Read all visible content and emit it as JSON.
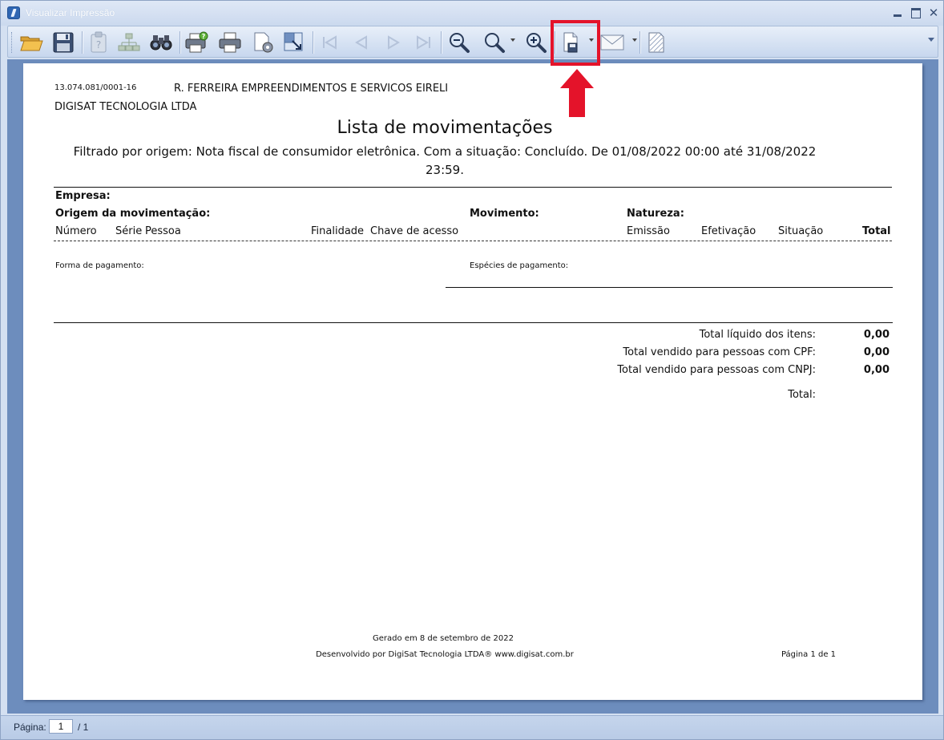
{
  "window": {
    "title": "Visualizar Impressão"
  },
  "toolbar": {
    "buttons": [
      {
        "name": "open-button",
        "icon": "folder-open-icon"
      },
      {
        "name": "save-button",
        "icon": "floppy-disk-icon"
      },
      {
        "name": "parameters-button",
        "icon": "clipboard-icon"
      },
      {
        "name": "document-map-button",
        "icon": "hierarchy-icon"
      },
      {
        "name": "find-button",
        "icon": "binoculars-icon"
      },
      {
        "name": "quick-print-button",
        "icon": "printer-check-icon"
      },
      {
        "name": "print-button",
        "icon": "printer-icon"
      },
      {
        "name": "page-setup-button",
        "icon": "page-gear-icon"
      },
      {
        "name": "scale-button",
        "icon": "page-arrow-icon"
      },
      {
        "name": "first-page-button",
        "icon": "first-page-icon"
      },
      {
        "name": "previous-page-button",
        "icon": "previous-page-icon"
      },
      {
        "name": "next-page-button",
        "icon": "next-page-icon"
      },
      {
        "name": "last-page-button",
        "icon": "last-page-icon"
      },
      {
        "name": "zoom-out-button",
        "icon": "zoom-out-icon"
      },
      {
        "name": "zoom-button",
        "icon": "magnifier-icon"
      },
      {
        "name": "zoom-in-button",
        "icon": "zoom-in-icon"
      },
      {
        "name": "export-button",
        "icon": "export-document-icon"
      },
      {
        "name": "send-email-button",
        "icon": "envelope-icon"
      },
      {
        "name": "watermark-button",
        "icon": "watermark-icon"
      }
    ],
    "accent_highlight": "#e4132a"
  },
  "report": {
    "cnpj": "13.074.081/0001-16",
    "company_name": "R. FERREIRA EMPREENDIMENTOS E SERVICOS EIRELI",
    "developer_company": "DIGISAT TECNOLOGIA LTDA",
    "title": "Lista de movimentações",
    "filter_line1": "Filtrado por origem: Nota fiscal de consumidor eletrônica. Com a situação: Concluído. De 01/08/2022 00:00 até 31/08/2022",
    "filter_line2": "23:59.",
    "headers": {
      "empresa": "Empresa:",
      "origem": "Origem da movimentação:",
      "movimento": "Movimento:",
      "natureza": "Natureza:"
    },
    "columns": {
      "numero": "Número",
      "serie": "Série",
      "pessoa": "Pessoa",
      "finalidade": "Finalidade",
      "chave": "Chave de acesso",
      "emissao": "Emissão",
      "efetivacao": "Efetivação",
      "situacao": "Situação",
      "total": "Total"
    },
    "forma_pagamento_label": "Forma de pagamento:",
    "especies_pagamento_label": "Espécies de pagamento:",
    "totals": [
      {
        "label": "Total líquido dos itens:",
        "value": "0,00"
      },
      {
        "label": "Total vendido para pessoas com CPF:",
        "value": "0,00"
      },
      {
        "label": "Total vendido para pessoas com CNPJ:",
        "value": "0,00"
      },
      {
        "label": "Total:",
        "value": ""
      }
    ],
    "footer": {
      "generated": "Gerado em 8 de setembro de 2022",
      "developed_by": "Desenvolvido por DigiSat Tecnologia LTDA®   www.digisat.com.br",
      "page_info": "Página 1 de 1"
    }
  },
  "statusbar": {
    "page_label": "Página:",
    "current_page": "1",
    "total_pages": "/ 1"
  }
}
